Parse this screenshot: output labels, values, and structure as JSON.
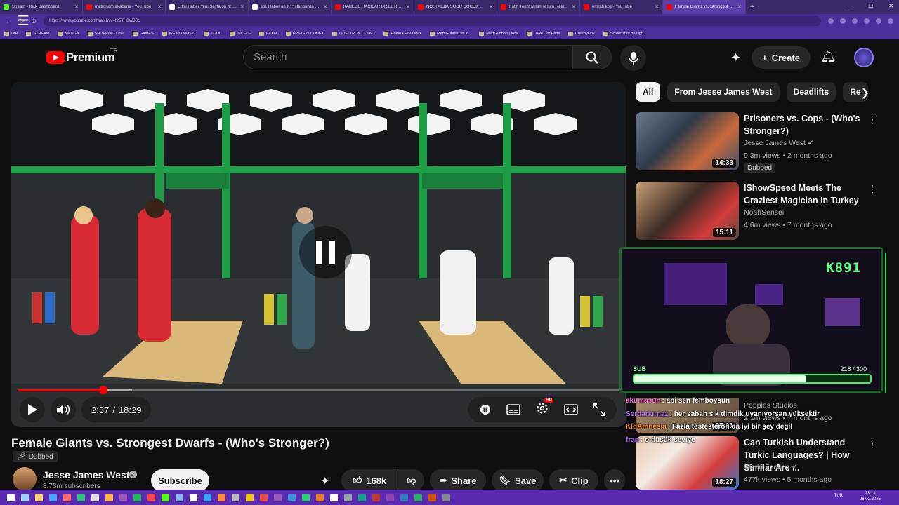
{
  "browser": {
    "tabs": [
      {
        "title": "Stream - Kick Dashboard",
        "color": "#53fc18",
        "active": false
      },
      {
        "title": "metronom akademi - YouTube",
        "color": "#ff0000",
        "active": false
      },
      {
        "title": "Etkili Haber Yeni Sayfa on X: \"Mura...",
        "color": "#ffffff",
        "active": false
      },
      {
        "title": "sol. Haber on X: \"İstanbul'da ortaokul...",
        "color": "#ffffff",
        "active": false
      },
      {
        "title": "KABEDE HACILAR DRILL REMIX(prod...",
        "color": "#ff0000",
        "active": false
      },
      {
        "title": "NOSTALJİK SUCU ÇOCUK 1995 REMIX...",
        "color": "#ff0000",
        "active": false
      },
      {
        "title": "Fatih Terim Milan Telsim Reklamı...",
        "color": "#ff0000",
        "active": false
      },
      {
        "title": "emrah koş - YouTube",
        "color": "#ff0000",
        "active": false
      },
      {
        "title": "Female Giants vs. Strongest D...",
        "color": "#ff0000",
        "active": true
      }
    ],
    "new_tab": "+",
    "url": "https://www.youtube.com/watch?v=f25TH8W38c",
    "bookmarks": [
      "DIR",
      "STREAM",
      "MANGA",
      "SHOPPING LIST",
      "GAMES",
      "WEIRD MUSIC",
      "TOOL",
      "İNCELE",
      "FFXIV",
      "EPSTEIN CODEX",
      "QUELTRON CODEX",
      "Home • HBO Max",
      "Mert Günhan ve Y...",
      "MertGunhan | Kick",
      "LIVAD for Fans",
      "CreepyLink",
      "Screenshot by Ligh..."
    ]
  },
  "youtube": {
    "logo_text": "Premium",
    "region": "TR",
    "search_placeholder": "Search",
    "create_label": "Create"
  },
  "player": {
    "current_time": "2:37",
    "duration": "18:29",
    "progress": 0.142,
    "buffered": 0.19,
    "hd_badge": "HD"
  },
  "video": {
    "title": "Female Giants vs. Strongest Dwarfs - (Who's Stronger?)",
    "dubbed": "Dubbed",
    "channel": "Jesse James West",
    "subscribers": "8.73m subscribers",
    "subscribe_label": "Subscribe",
    "likes": "168k",
    "share_label": "Share",
    "save_label": "Save",
    "clip_label": "Clip"
  },
  "chips": [
    "All",
    "From Jesse James West",
    "Deadlifts",
    "Re"
  ],
  "recommendations": [
    {
      "title": "Prisoners vs. Cops - (Who's Stronger?)",
      "channel": "Jesse James West",
      "verified": true,
      "meta": "9.3m views • 2 months ago",
      "duration": "14:33",
      "badge": "Dubbed"
    },
    {
      "title": "IShowSpeed Meets The Craziest Magician In Turkey",
      "channel": "NoahSensei",
      "verified": false,
      "meta": "4.6m views • 7 months ago",
      "duration": "15:11",
      "badge": ""
    },
    {
      "title": "",
      "channel": "Poppies Studios",
      "verified": false,
      "meta": "1.1m views • 7 months ago",
      "duration": "37:01",
      "badge": ""
    },
    {
      "title": "Can Turkish Understand Turkic Languages? | How Similar Are ...",
      "channel": "World Friends",
      "verified": true,
      "meta": "477k views • 5 months ago",
      "duration": "18:27",
      "badge": ""
    }
  ],
  "overlay": {
    "counter": "K891",
    "sub_label": "SUB",
    "sub_current": 218,
    "sub_goal": 300,
    "sub_text": "218 / 300"
  },
  "chat": [
    {
      "user": "akumasun",
      "text": ": abi sen femboysun",
      "color": "#ff6ad5"
    },
    {
      "user": "Serdarkırnaz",
      "text": ": her sabah sık dimdik uyanıyorsan yüksektir",
      "color": "#b46bff"
    },
    {
      "user": "KidAmnesia",
      "text": ": Fazla testesteron da iyi bir şey değil",
      "color": "#ff8a3d"
    },
    {
      "user": "fran",
      "text": ": o düşük seviye",
      "color": "#b46bff"
    }
  ],
  "taskbar": {
    "time": "23:13",
    "date": "26.02.2026",
    "lang": "TUR"
  }
}
